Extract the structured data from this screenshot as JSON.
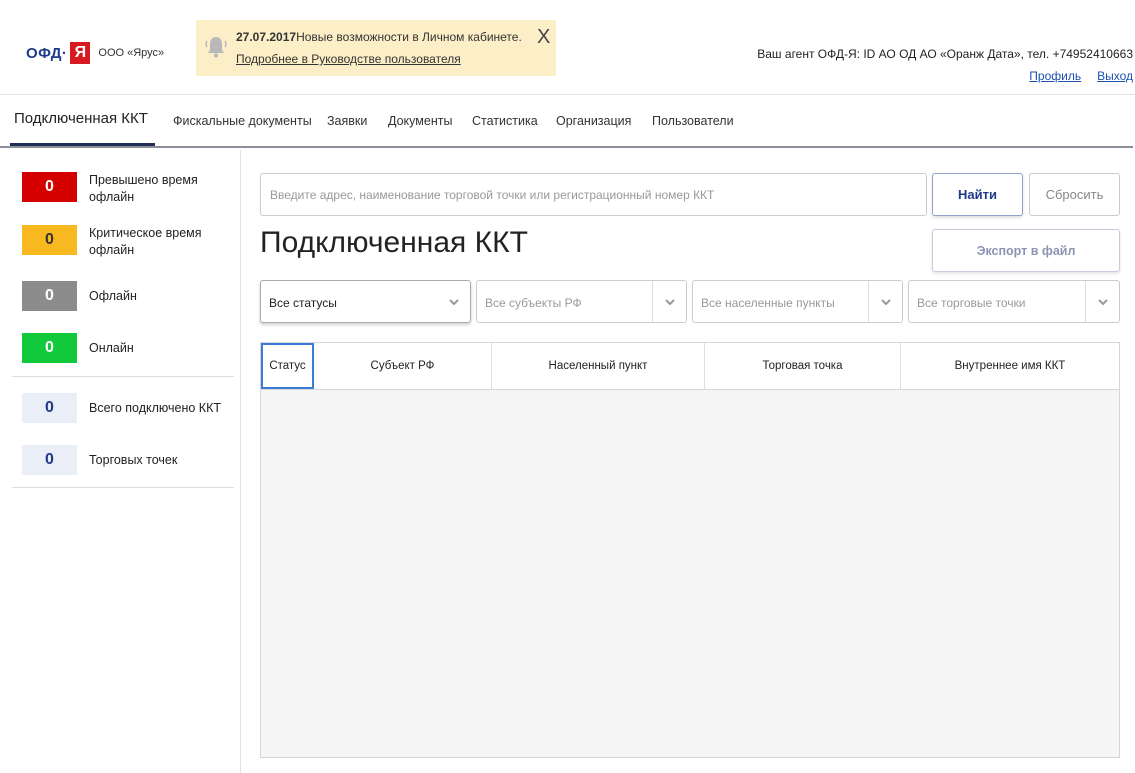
{
  "header": {
    "logo_ofd": "ОФД·",
    "logo_ya": "Я",
    "org_name": "ООО «Ярус»",
    "notice": {
      "date": "27.07.2017",
      "text": "Новые возможности в Личном кабинете.",
      "link": "Подробнее в Руководстве пользователя",
      "close": "X"
    },
    "agent": "Ваш агент ОФД-Я: ID АО ОД АО «Оранж Дата», тел. +74952410663",
    "profile": "Профиль",
    "logout": "Выход"
  },
  "tabs": [
    {
      "label": "Подключенная ККТ"
    },
    {
      "label": "Фискальные документы"
    },
    {
      "label": "Заявки"
    },
    {
      "label": "Документы"
    },
    {
      "label": "Статистика"
    },
    {
      "label": "Организация"
    },
    {
      "label": "Пользователи"
    }
  ],
  "sidebar": {
    "stats": [
      {
        "value": "0",
        "label": "Превышено время офлайн",
        "color": "#d40000"
      },
      {
        "value": "0",
        "label": "Критическое время офлайн",
        "color": "#f8b820"
      },
      {
        "value": "0",
        "label": "Офлайн",
        "color": "#8c8c8c"
      },
      {
        "value": "0",
        "label": "Онлайн",
        "color": "#11c93a"
      }
    ],
    "totals": [
      {
        "value": "0",
        "label": "Всего подключено ККТ"
      },
      {
        "value": "0",
        "label": "Торговых точек"
      }
    ]
  },
  "search": {
    "placeholder": "Введите адрес, наименование торговой точки или регистрационный номер ККТ",
    "find_label": "Найти",
    "reset_label": "Сбросить"
  },
  "main": {
    "title": "Подключенная ККТ",
    "export_label": "Экспорт в файл"
  },
  "filters": [
    {
      "value": "Все статусы"
    },
    {
      "value": "Все субъекты РФ"
    },
    {
      "value": "Все населенные пункты"
    },
    {
      "value": "Все торговые точки"
    }
  ],
  "table": {
    "columns": [
      "Статус",
      "Субъект РФ",
      "Населенный пункт",
      "Торговая точка",
      "Внутреннее имя ККТ"
    ]
  },
  "colors": {
    "accent": "#1e3a8a",
    "brand_red": "#d71920",
    "notice_bg": "#fcefc7"
  }
}
